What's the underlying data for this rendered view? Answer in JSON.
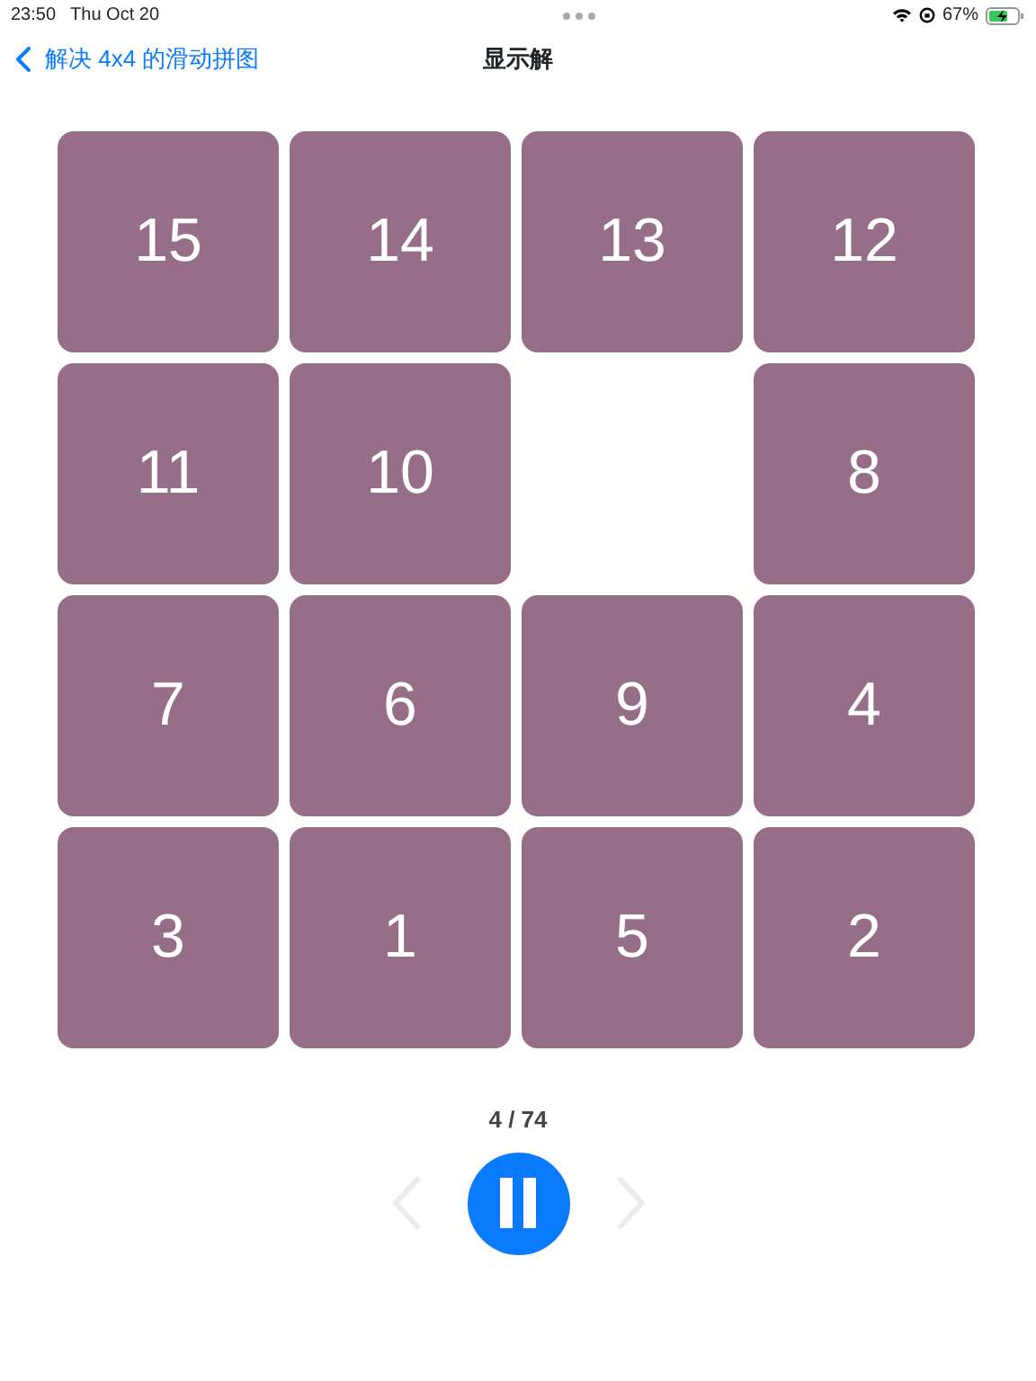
{
  "status_bar": {
    "time": "23:50",
    "date": "Thu Oct 20",
    "battery": "67%"
  },
  "nav": {
    "back": "解决 4x4 的滑动拼图",
    "title": "显示解"
  },
  "board": [
    {
      "kind": "tile",
      "label": "15"
    },
    {
      "kind": "tile",
      "label": "14"
    },
    {
      "kind": "tile",
      "label": "13"
    },
    {
      "kind": "tile",
      "label": "12"
    },
    {
      "kind": "tile",
      "label": "11"
    },
    {
      "kind": "tile",
      "label": "10"
    },
    {
      "kind": "empty"
    },
    {
      "kind": "tile",
      "label": "8"
    },
    {
      "kind": "tile",
      "label": "7"
    },
    {
      "kind": "tile",
      "label": "6"
    },
    {
      "kind": "tile",
      "label": "9"
    },
    {
      "kind": "tile",
      "label": "4"
    },
    {
      "kind": "tile",
      "label": "3"
    },
    {
      "kind": "tile",
      "label": "1"
    },
    {
      "kind": "tile",
      "label": "5"
    },
    {
      "kind": "tile",
      "label": "2"
    }
  ],
  "progress": "4 / 74",
  "controls": {
    "previous_disabled": true,
    "next_disabled": true,
    "playing": true
  }
}
